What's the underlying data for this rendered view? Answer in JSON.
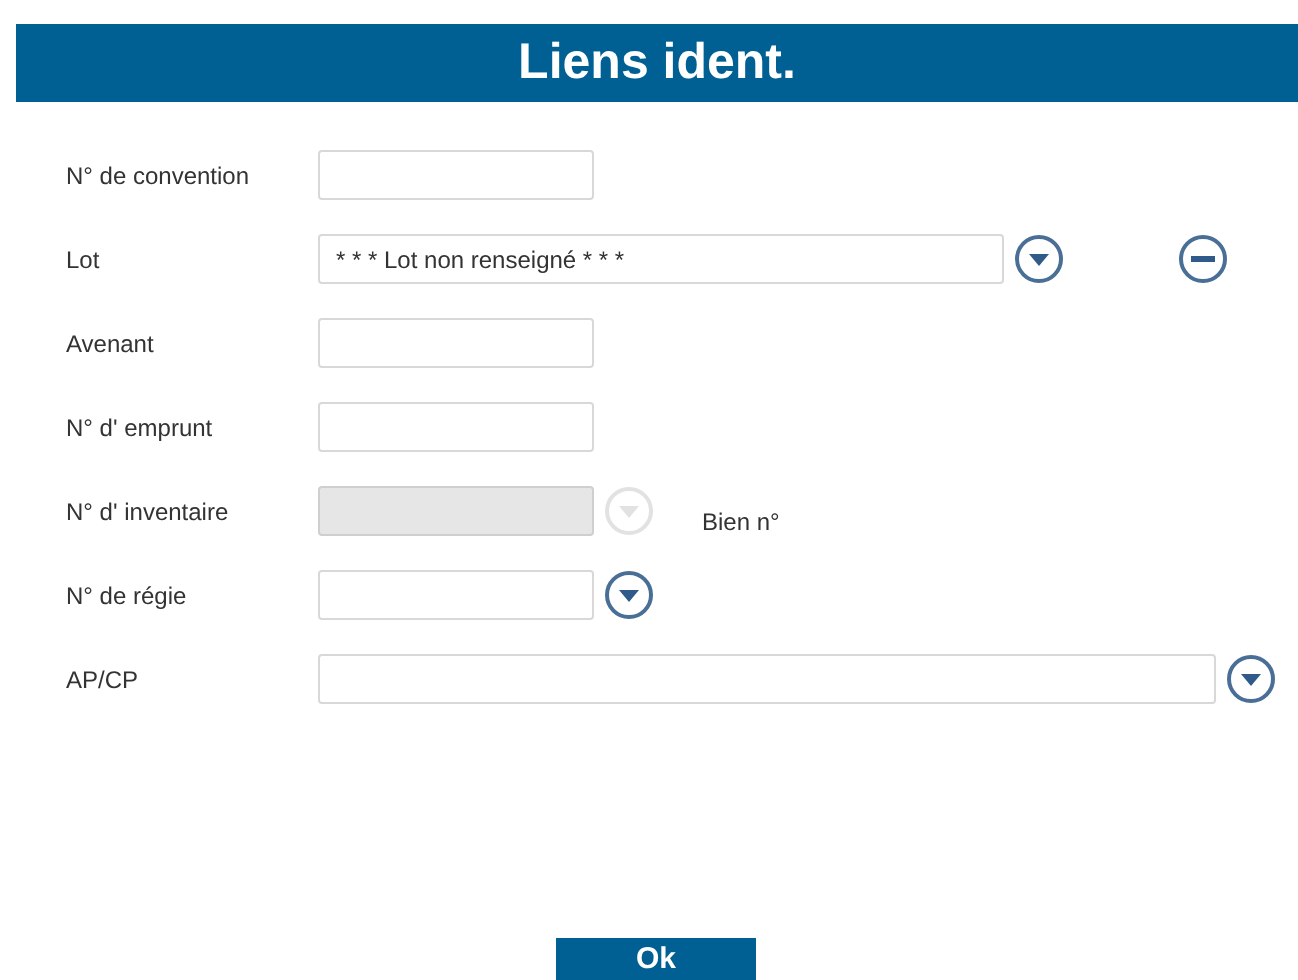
{
  "title": "Liens  ident.",
  "fields": [
    {
      "label": "N° de convention",
      "kind": "text",
      "disabled": false
    },
    {
      "label": "Lot",
      "kind": "combo",
      "value": "* * * Lot non renseigné * * *",
      "disabled": false,
      "dropdown": true,
      "remove": true
    },
    {
      "label": "Avenant",
      "kind": "text",
      "disabled": false
    },
    {
      "label": "N° d' emprunt",
      "kind": "text",
      "disabled": false
    },
    {
      "label": "N° d' inventaire",
      "kind": "text",
      "disabled": true,
      "dropdown": true,
      "note": "Bien n°"
    },
    {
      "label": "N° de régie",
      "kind": "text",
      "disabled": false,
      "dropdown": true
    },
    {
      "label": "AP/CP",
      "kind": "wide-combo",
      "disabled": false,
      "dropdown": true
    }
  ],
  "ok_button": "Ok"
}
